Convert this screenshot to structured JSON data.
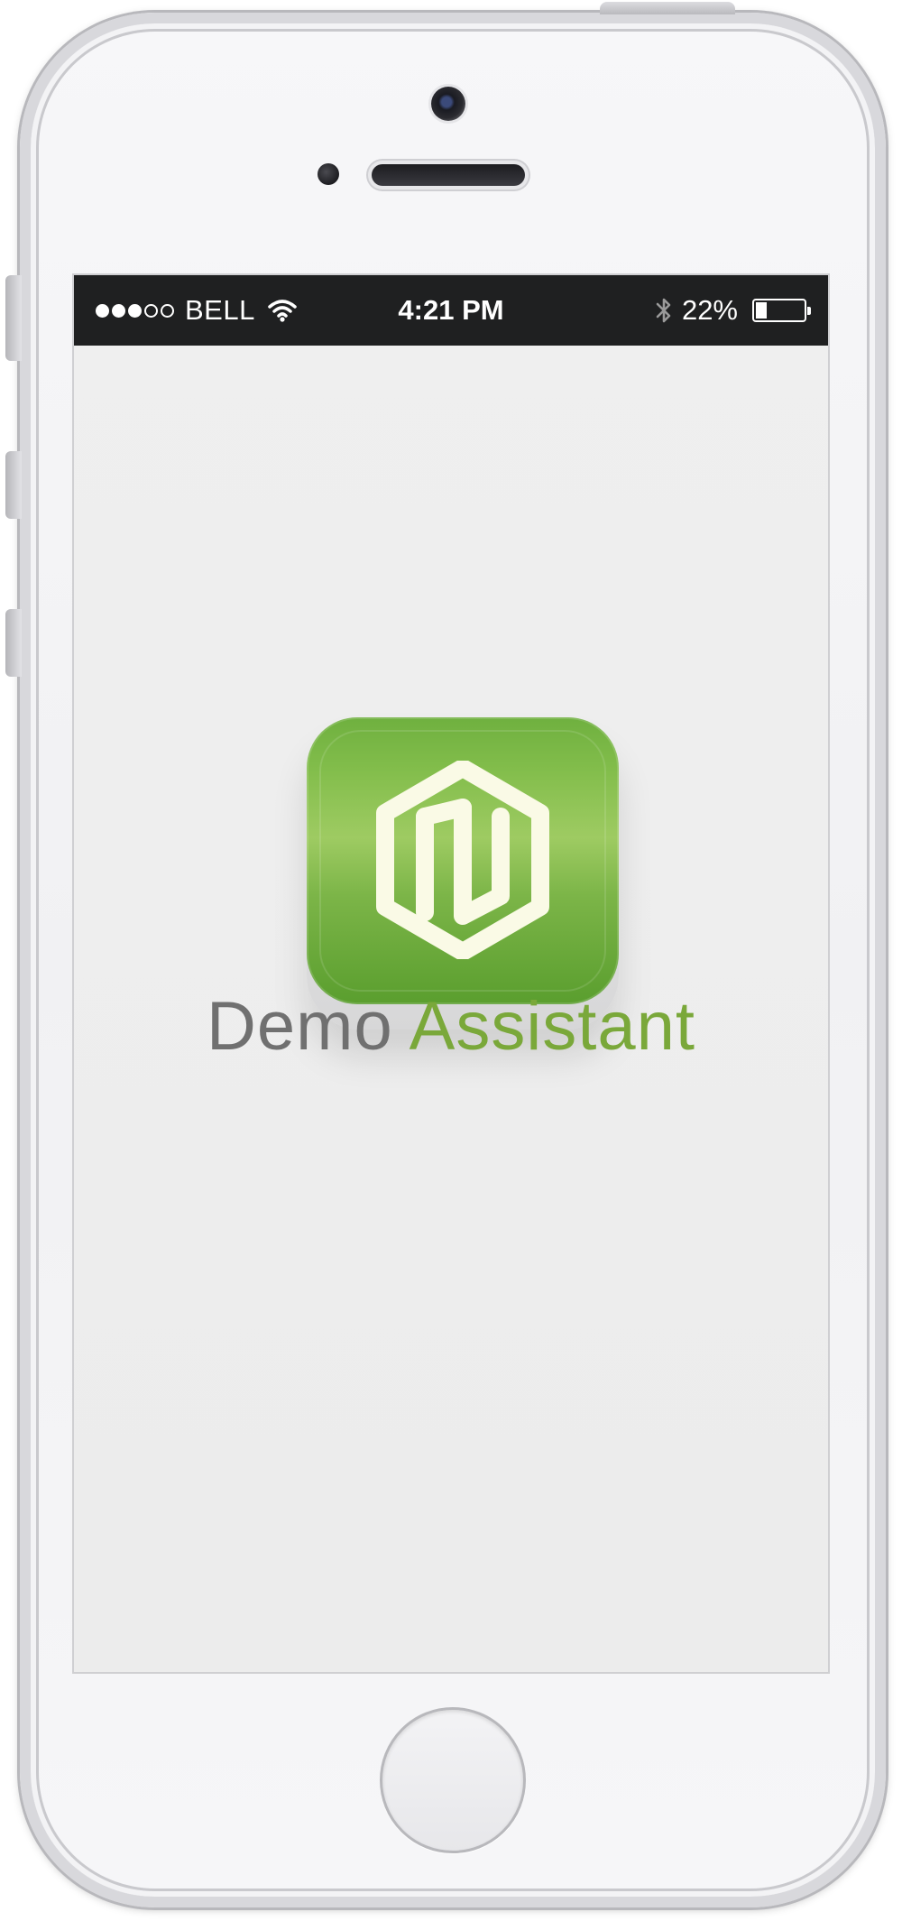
{
  "status_bar": {
    "signal_filled": 3,
    "signal_total": 5,
    "carrier": "BELL",
    "time": "4:21 PM",
    "battery_percent": "22%",
    "battery_level": 0.22,
    "icons": [
      "wifi-icon",
      "bluetooth-icon",
      "battery-icon"
    ]
  },
  "app": {
    "name_word_1": "Demo",
    "name_word_2": "Assistant",
    "icon": "hexagon-logo-icon",
    "colors": {
      "icon_green_top": "#6fb03f",
      "icon_green_mid": "#9ecb62",
      "icon_green_bottom": "#5a9e2e",
      "logo_cream": "#fafae6",
      "word_1": "#707070",
      "word_2": "#7aa83a"
    }
  },
  "device": {
    "hardware": [
      "camera",
      "sensor",
      "speaker",
      "home-button",
      "power-button",
      "volume-buttons"
    ]
  }
}
